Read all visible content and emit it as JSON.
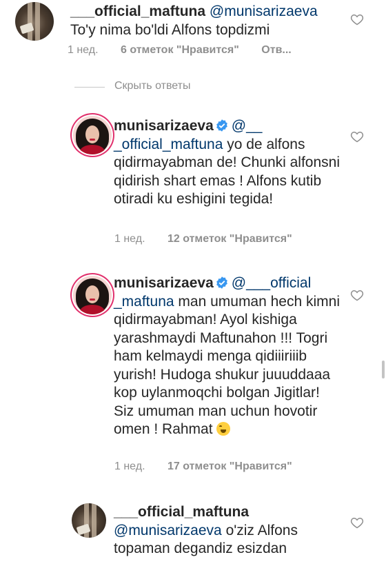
{
  "hide_replies": "Скрыть ответы",
  "comments": [
    {
      "username": "___official_maftuna",
      "mention": "@munisarizaeva",
      "text": "To'y nima bo'ldi Alfons topdizmi",
      "time": "1 нед.",
      "likes": "6 отметок \"Нравится\"",
      "reply": "Отв...",
      "avatar": "photo-avatar"
    },
    {
      "username": "munisarizaeva",
      "verified": true,
      "mention": "@__ _official_maftuna",
      "text": "yo de alfons qidirmayabman de! Chunki alfonsni qidirish shart emas ! Alfons kutib otiradi ku eshigini tegida!",
      "time": "1 нед.",
      "likes": "12 отметок \"Нравится\"",
      "avatar": "profile-avatar"
    },
    {
      "username": "munisarizaeva",
      "verified": true,
      "mention": "@___official _maftuna",
      "text": "man umuman hech kimni qidirmayabman! Ayol kishiga yarashmaydi Maftunahon !!! Togri ham kelmaydi menga qidiiiriiib yurish! Hudoga shukur juuuddaaa kop uylanmoqchi bolgan Jigitlar! Siz umuman man uchun hovotir omen ! Rahmat",
      "emoji": "laughing-emoji",
      "time": "1 нед.",
      "likes": "17 отметок \"Нравится\"",
      "avatar": "profile-avatar"
    },
    {
      "username": "___official_maftuna",
      "mention": "@munisarizaeva",
      "text": "o'ziz Alfons topaman degandiz esizdan",
      "avatar": "photo-avatar"
    }
  ]
}
